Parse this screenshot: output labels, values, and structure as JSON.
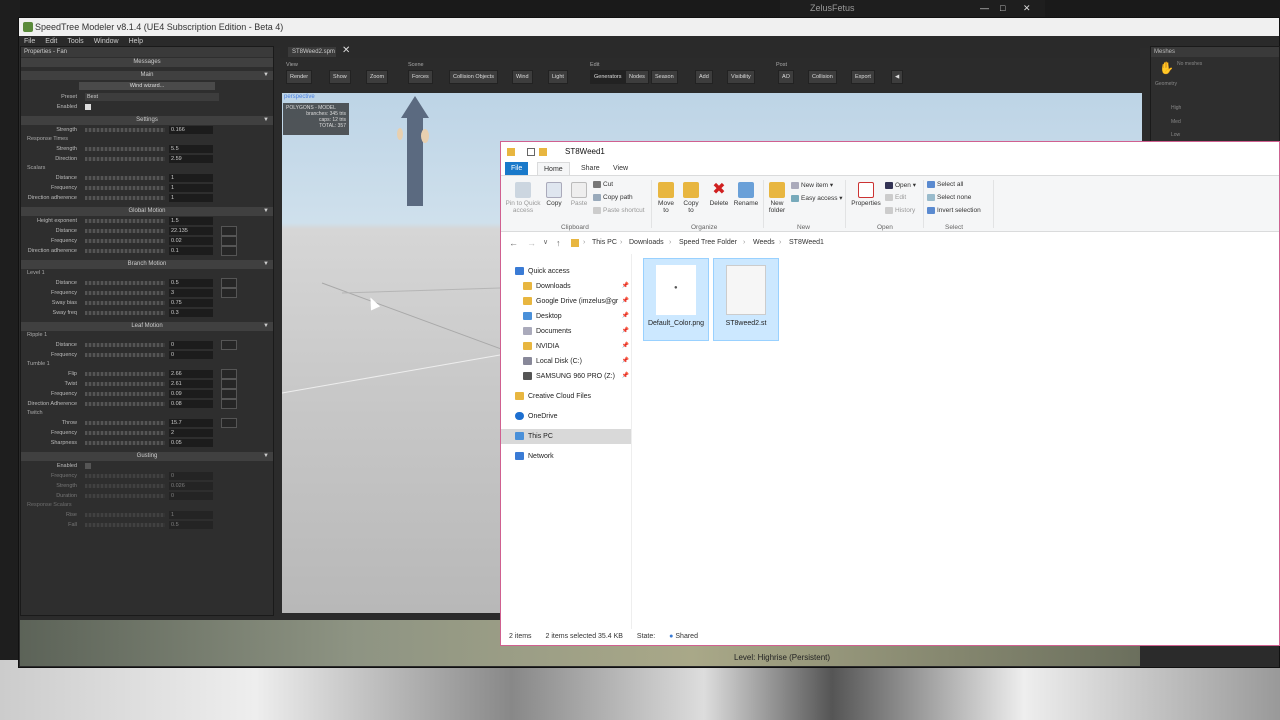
{
  "speedtree": {
    "title": "SpeedTree Modeler v8.1.4 (UE4 Subscription Edition - Beta 4)",
    "menu": [
      "File",
      "Edit",
      "Tools",
      "Window",
      "Help"
    ],
    "user": "ZelusFetus",
    "properties": {
      "title": "Properties - Fan",
      "messages": "Messages",
      "main": {
        "header": "Main",
        "wind_wizard": "Wind wizard...",
        "preset_label": "Preset",
        "preset_value": "Best",
        "enabled_label": "Enabled"
      },
      "settings": {
        "header": "Settings",
        "strength_label": "Strength",
        "strength_value": "0.166",
        "response_times": "Response Times",
        "rt_strength_label": "Strength",
        "rt_strength_value": "5.5",
        "rt_direction_label": "Direction",
        "rt_direction_value": "2.59",
        "scalars": "Scalars",
        "sc_distance_label": "Distance",
        "sc_distance_value": "1",
        "sc_frequency_label": "Frequency",
        "sc_frequency_value": "1",
        "sc_diradh_label": "Direction adherence",
        "sc_diradh_value": "1"
      },
      "global_motion": {
        "header": "Global Motion",
        "height_exp_label": "Height exponent",
        "height_exp_value": "1.5",
        "distance_label": "Distance",
        "distance_value": "22.135",
        "frequency_label": "Frequency",
        "frequency_value": "0.02",
        "diradh_label": "Direction adherence",
        "diradh_value": "0.1"
      },
      "branch_motion": {
        "header": "Branch Motion",
        "level": "Level 1",
        "distance_label": "Distance",
        "distance_value": "0.5",
        "frequency_label": "Frequency",
        "frequency_value": "3",
        "sway_bias_label": "Sway bias",
        "sway_bias_value": "0.75",
        "sway_freq_label": "Sway freq",
        "sway_freq_value": "0.3"
      },
      "leaf_motion": {
        "header": "Leaf Motion",
        "ripple": "Ripple 1",
        "r_distance_label": "Distance",
        "r_distance_value": "0",
        "r_frequency_label": "Frequency",
        "r_frequency_value": "0",
        "tumble": "Tumble 1",
        "flip_label": "Flip",
        "flip_value": "2.66",
        "twist_label": "Twist",
        "twist_value": "2.61",
        "t_frequency_label": "Frequency",
        "t_frequency_value": "0.09",
        "t_diradh_label": "Direction Adherence",
        "t_diradh_value": "0.08",
        "twitch": "Twitch",
        "throw_label": "Throw",
        "throw_value": "15.7",
        "tw_frequency_label": "Frequency",
        "tw_frequency_value": "2",
        "sharpness_label": "Sharpness",
        "sharpness_value": "0.05"
      },
      "gusting": {
        "header": "Gusting",
        "enabled_label": "Enabled",
        "frequency_label": "Frequency",
        "frequency_value": "0",
        "strength_label": "Strength",
        "strength_value": "0.026",
        "duration_label": "Duration",
        "duration_value": "0",
        "response_scalars": "Response Scalars",
        "rise_label": "Rise",
        "rise_value": "1",
        "fall_label": "Fall",
        "fall_value": "0.5"
      }
    },
    "tab": "ST8Weed2.spm",
    "toolbar": {
      "groups": [
        "View",
        "Scene",
        "Edit",
        "Post"
      ],
      "view": [
        "Render",
        "Show",
        "Zoom"
      ],
      "scene": [
        "Forces",
        "Collision Objects",
        "Wind",
        "Light"
      ],
      "edit": [
        "Generators",
        "Nodes",
        "Season",
        "Add",
        "Visibility"
      ],
      "post": [
        "AO",
        "Collision",
        "Export"
      ]
    },
    "viewport": {
      "label": "perspective",
      "poly_title": "POLYGONS - MODEL",
      "poly_lines": [
        "branches: 345 tris",
        "caps: 12 tris",
        "TOTAL: 357"
      ]
    },
    "meshes": {
      "title": "Meshes",
      "none": "No meshes",
      "geometry": "Geometry",
      "lods": [
        "High",
        "Med",
        "Low"
      ]
    },
    "level_text": "Level: Highrise (Persistent)"
  },
  "explorer": {
    "title": "ST8Weed1",
    "tabs": [
      "File",
      "Home",
      "Share",
      "View"
    ],
    "ribbon": {
      "clipboard": {
        "pin": "Pin to Quick access",
        "copy": "Copy",
        "paste": "Paste",
        "cut": "Cut",
        "copy_path": "Copy path",
        "paste_shortcut": "Paste shortcut",
        "group": "Clipboard"
      },
      "organize": {
        "move_to": "Move to",
        "copy_to": "Copy to",
        "delete": "Delete",
        "rename": "Rename",
        "group": "Organize"
      },
      "new": {
        "new_folder": "New folder",
        "new_item": "New item",
        "easy_access": "Easy access",
        "group": "New"
      },
      "open": {
        "properties": "Properties",
        "open": "Open",
        "edit": "Edit",
        "history": "History",
        "group": "Open"
      },
      "select": {
        "select_all": "Select all",
        "select_none": "Select none",
        "invert": "Invert selection",
        "group": "Select"
      }
    },
    "breadcrumb": [
      "This PC",
      "Downloads",
      "Speed Tree Folder",
      "Weeds",
      "ST8Weed1"
    ],
    "nav": {
      "quick_access": "Quick access",
      "items": [
        "Downloads",
        "Google Drive (imzelus@gr",
        "Desktop",
        "Documents",
        "NVIDIA",
        "Local Disk (C:)",
        "SAMSUNG 960 PRO (Z:)"
      ],
      "creative_cloud": "Creative Cloud Files",
      "onedrive": "OneDrive",
      "this_pc": "This PC",
      "network": "Network"
    },
    "files": [
      {
        "name": "Default_Color.png"
      },
      {
        "name": "ST8weed2.st"
      }
    ],
    "status": {
      "count": "2 items",
      "selected": "2 items selected  35.4 KB",
      "state": "State:",
      "shared": "Shared"
    }
  },
  "colors": {
    "explorer_accent": "#1979ca",
    "selection": "#cce8ff",
    "viewport_label": "#4a7fe0"
  }
}
